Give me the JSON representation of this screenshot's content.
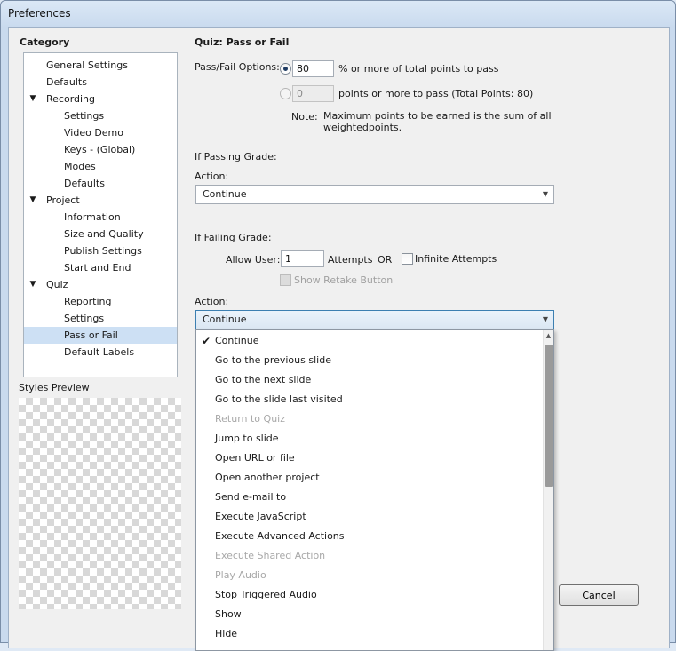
{
  "window": {
    "title": "Preferences"
  },
  "sidebar": {
    "heading": "Category",
    "items": [
      {
        "label": "General Settings",
        "level": 1,
        "expander": ""
      },
      {
        "label": "Defaults",
        "level": 1,
        "expander": ""
      },
      {
        "label": "Recording",
        "level": 1,
        "expander": "▼"
      },
      {
        "label": "Settings",
        "level": 2,
        "expander": ""
      },
      {
        "label": "Video Demo",
        "level": 2,
        "expander": ""
      },
      {
        "label": "Keys - (Global)",
        "level": 2,
        "expander": ""
      },
      {
        "label": "Modes",
        "level": 2,
        "expander": ""
      },
      {
        "label": "Defaults",
        "level": 2,
        "expander": ""
      },
      {
        "label": "Project",
        "level": 1,
        "expander": "▼"
      },
      {
        "label": "Information",
        "level": 2,
        "expander": ""
      },
      {
        "label": "Size and Quality",
        "level": 2,
        "expander": ""
      },
      {
        "label": "Publish Settings",
        "level": 2,
        "expander": ""
      },
      {
        "label": "Start and End",
        "level": 2,
        "expander": ""
      },
      {
        "label": "Quiz",
        "level": 1,
        "expander": "▼"
      },
      {
        "label": "Reporting",
        "level": 2,
        "expander": ""
      },
      {
        "label": "Settings",
        "level": 2,
        "expander": ""
      },
      {
        "label": "Pass or Fail",
        "level": 2,
        "expander": "",
        "selected": true
      },
      {
        "label": "Default Labels",
        "level": 2,
        "expander": ""
      }
    ],
    "styles_preview_label": "Styles Preview"
  },
  "main": {
    "title": "Quiz: Pass or Fail",
    "pass_fail_label": "Pass/Fail Options:",
    "percent_value": "80",
    "percent_text": "% or more of total points to pass",
    "points_value": "0",
    "points_text": "points or more to pass (Total Points: 80)",
    "note_label": "Note:",
    "note_line1": "Maximum points to be earned is the sum of all",
    "note_line2": "weightedpoints.",
    "passing_heading": "If Passing Grade:",
    "passing_action_label": "Action:",
    "passing_action_value": "Continue",
    "failing_heading": "If Failing Grade:",
    "allow_user_label": "Allow User:",
    "attempts_value": "1",
    "attempts_label": "Attempts",
    "or_label": "OR",
    "infinite_label": "Infinite Attempts",
    "retake_label": "Show Retake Button",
    "failing_action_label": "Action:",
    "failing_action_value": "Continue"
  },
  "dropdown_options": [
    {
      "label": "Continue",
      "checked": true,
      "disabled": false
    },
    {
      "label": "Go to the previous slide",
      "checked": false,
      "disabled": false
    },
    {
      "label": "Go to the next slide",
      "checked": false,
      "disabled": false
    },
    {
      "label": "Go to the slide last visited",
      "checked": false,
      "disabled": false
    },
    {
      "label": "Return to Quiz",
      "checked": false,
      "disabled": true
    },
    {
      "label": "Jump to slide",
      "checked": false,
      "disabled": false
    },
    {
      "label": "Open URL or file",
      "checked": false,
      "disabled": false
    },
    {
      "label": "Open another project",
      "checked": false,
      "disabled": false
    },
    {
      "label": "Send e-mail to",
      "checked": false,
      "disabled": false
    },
    {
      "label": "Execute JavaScript",
      "checked": false,
      "disabled": false
    },
    {
      "label": "Execute Advanced Actions",
      "checked": false,
      "disabled": false
    },
    {
      "label": "Execute Shared Action",
      "checked": false,
      "disabled": true
    },
    {
      "label": "Play Audio",
      "checked": false,
      "disabled": true
    },
    {
      "label": "Stop Triggered Audio",
      "checked": false,
      "disabled": false
    },
    {
      "label": "Show",
      "checked": false,
      "disabled": false
    },
    {
      "label": "Hide",
      "checked": false,
      "disabled": false
    }
  ],
  "buttons": {
    "cancel": "Cancel"
  },
  "icons": {
    "checkmark": "✔",
    "expand": "▼",
    "dropdown": "▼",
    "scroll_up": "▲"
  }
}
